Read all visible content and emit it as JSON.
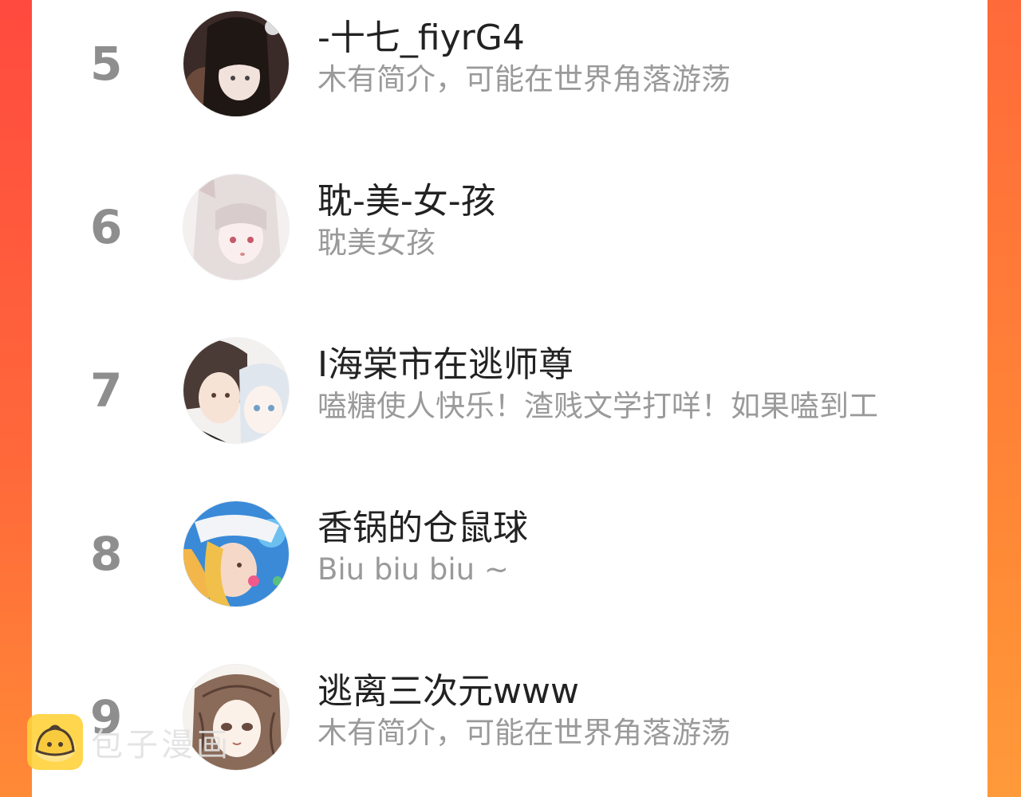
{
  "colors": {
    "background_gradient": [
      "#ff4a3f",
      "#ff8a36"
    ],
    "rank_color": "#8e8e8e",
    "name_color": "#222222",
    "bio_color": "#9a9a9a",
    "watermark_logo": "#ffd23a"
  },
  "users": [
    {
      "rank": "5",
      "name": "-十七_fiyrG4",
      "bio": "木有简介，可能在世界角落游荡",
      "avatar_icon": "anime-girl-dark-hair-avatar"
    },
    {
      "rank": "6",
      "name": "耽-美-女-孩",
      "bio": "耽美女孩",
      "avatar_icon": "anime-girl-white-hair-avatar"
    },
    {
      "rank": "7",
      "name": "I海棠市在逃师尊",
      "bio": "嗑糖使人快乐！渣贱文学打咩！如果嗑到工",
      "avatar_icon": "anime-couple-avatar"
    },
    {
      "rank": "8",
      "name": "香锅的仓鼠球",
      "bio": "Biu biu biu ~",
      "avatar_icon": "anime-blonde-cap-avatar"
    },
    {
      "rank": "9",
      "name": "逃离三次元www",
      "bio": "木有简介，可能在世界角落游荡",
      "avatar_icon": "anime-brown-hair-sketch-avatar"
    }
  ],
  "watermark": {
    "text": "包子漫画",
    "logo_icon": "bun-logo-icon"
  }
}
